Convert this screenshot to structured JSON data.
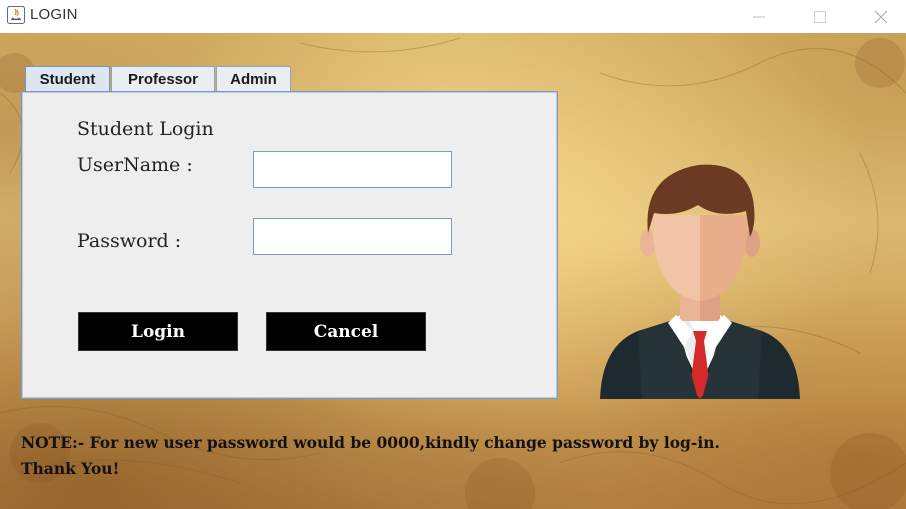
{
  "window": {
    "title": "LOGIN",
    "icon": "java-app-icon",
    "controls": [
      "minimize-icon",
      "maximize-icon",
      "close-icon"
    ]
  },
  "tabs": [
    {
      "label": "Student",
      "active": true
    },
    {
      "label": "Professor",
      "active": false
    },
    {
      "label": "Admin",
      "active": false
    }
  ],
  "form": {
    "heading": "Student Login",
    "username_label": "UserName :",
    "username_value": "",
    "password_label": "Password :",
    "password_value": "",
    "login_label": "Login",
    "cancel_label": "Cancel"
  },
  "note": {
    "line1": "NOTE:- For new user password would be 0000,kindly change password by log-in.",
    "line2": "Thank You!"
  },
  "colors": {
    "background": "#d9b56a",
    "panel": "#eeeeee",
    "button": "#000000",
    "tab_border": "#8fa4bf",
    "tie": "#d42a2a",
    "suit": "#1e2a2e",
    "hair": "#6b3a22",
    "skin": "#f2c4a7"
  }
}
